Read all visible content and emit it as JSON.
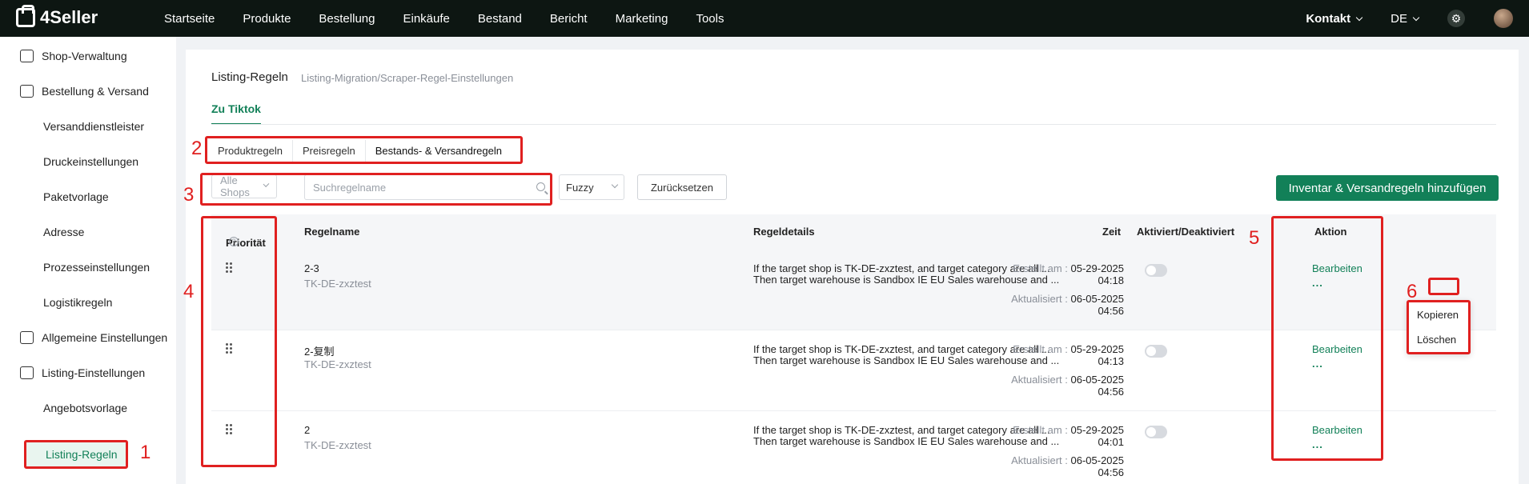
{
  "brand": {
    "name": "4Seller",
    "accent": "#128058",
    "topbar_bg": "#0d1612",
    "annotation_color": "#e02020"
  },
  "nav": [
    "Startseite",
    "Produkte",
    "Bestellung",
    "Einkäufe",
    "Bestand",
    "Bericht",
    "Marketing",
    "Tools"
  ],
  "top_right": {
    "contact": "Kontakt",
    "language": "DE"
  },
  "sidebar": [
    {
      "label": "Shop-Verwaltung",
      "icon": "store-icon"
    },
    {
      "label": "Bestellung & Versand",
      "icon": "order-bag-icon"
    },
    {
      "label": "Versanddienstleister"
    },
    {
      "label": "Druckeinstellungen"
    },
    {
      "label": "Paketvorlage"
    },
    {
      "label": "Adresse"
    },
    {
      "label": "Prozesseinstellungen"
    },
    {
      "label": "Logistikregeln"
    },
    {
      "label": "Allgemeine Einstellungen",
      "icon": "settings-stack-icon"
    },
    {
      "label": "Listing-Einstellungen",
      "icon": "upload-box-icon"
    },
    {
      "label": "Angebotsvorlage"
    },
    {
      "label": "Listing-Regeln",
      "active": true
    }
  ],
  "page": {
    "title": "Listing-Regeln",
    "subtitle": "Listing-Migration/Scraper-Regel-Einstellungen",
    "subtab": "Zu Tiktok",
    "rule_tabs": [
      "Produktregeln",
      "Preisregeln",
      "Bestands- & Versandregeln"
    ],
    "filters": {
      "shop_select": "Alle Shops",
      "search_placeholder": "Suchregelname",
      "match_mode": "Fuzzy",
      "reset": "Zurücksetzen"
    },
    "add_button": "Inventar & Versandregeln hinzufügen"
  },
  "table": {
    "columns": {
      "priority": "Priorität",
      "name": "Regelname",
      "details": "Regeldetails",
      "time": "Zeit",
      "enabled": "Aktiviert/Deaktiviert",
      "action": "Aktion"
    },
    "created_label": "Erstellt am :",
    "updated_label": "Aktualisiert :",
    "edit_label": "Bearbeiten",
    "more_label": "...",
    "rows": [
      {
        "name": "2-3",
        "shop": "TK-DE-zxztest",
        "detail1": "If the target shop is TK-DE-zxztest, and target category are all ...",
        "detail2": "Then target warehouse is Sandbox IE EU Sales warehouse and ...",
        "created_date": "05-29-2025",
        "created_time": "04:18",
        "updated_date": "06-05-2025",
        "updated_time": "04:56",
        "enabled": false
      },
      {
        "name": "2-复制",
        "shop": "TK-DE-zxztest",
        "detail1": "If the target shop is TK-DE-zxztest, and target category are all ...",
        "detail2": "Then target warehouse is Sandbox IE EU Sales warehouse and ...",
        "created_date": "05-29-2025",
        "created_time": "04:13",
        "updated_date": "06-05-2025",
        "updated_time": "04:56",
        "enabled": false
      },
      {
        "name": "2",
        "shop": "TK-DE-zxztest",
        "detail1": "If the target shop is TK-DE-zxztest, and target category are all ...",
        "detail2": "Then target warehouse is Sandbox IE EU Sales warehouse and ...",
        "created_date": "05-29-2025",
        "created_time": "04:01",
        "updated_date": "06-05-2025",
        "updated_time": "04:56",
        "enabled": false
      }
    ]
  },
  "more_menu": [
    "Kopieren",
    "Löschen"
  ],
  "annotations": [
    "1",
    "2",
    "3",
    "4",
    "5",
    "6"
  ]
}
